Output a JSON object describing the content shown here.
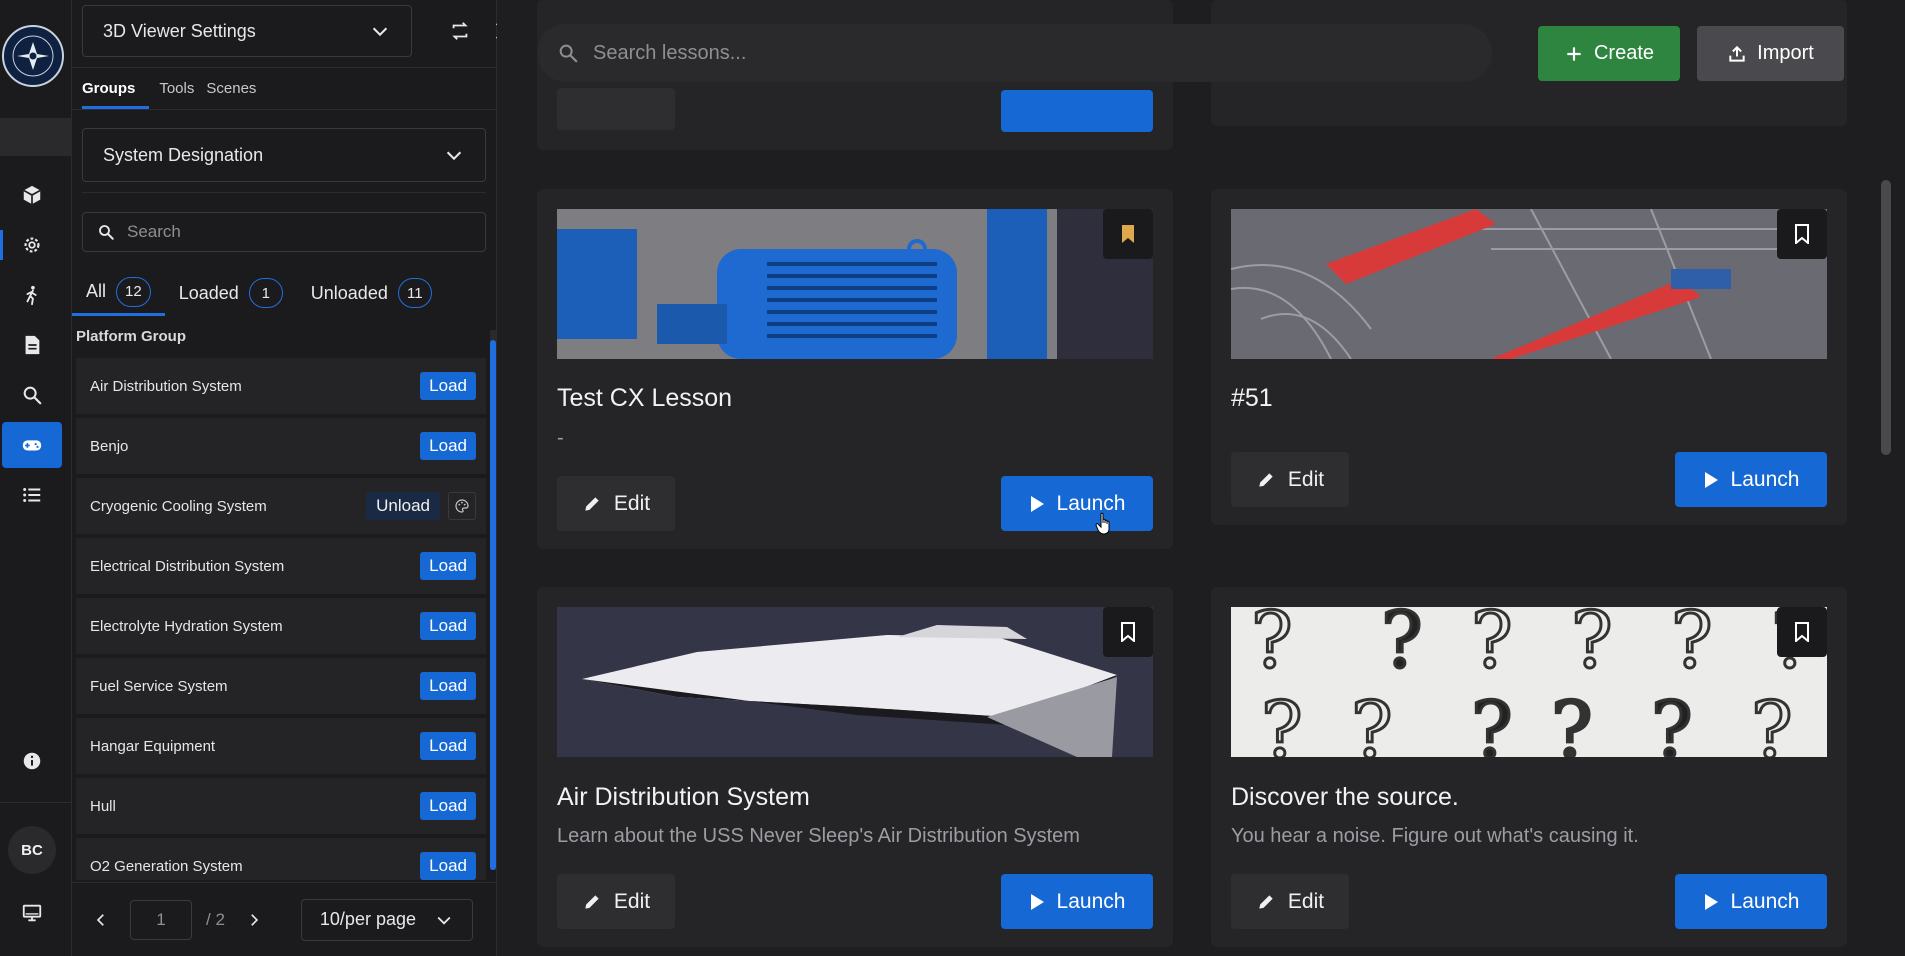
{
  "rail": {
    "avatar_initials": "BC",
    "items": [
      "cube-icon",
      "gear-icon",
      "walk-icon",
      "document-icon",
      "search-icon",
      "gamepad-icon",
      "list-icon"
    ],
    "active_item": "gamepad-icon",
    "selected_item": "gear-icon"
  },
  "panel": {
    "title": "3D Viewer Settings",
    "tabs": [
      {
        "label": "Groups",
        "active": true
      },
      {
        "label": "Tools",
        "active": false
      },
      {
        "label": "Scenes",
        "active": false
      }
    ],
    "designation_select": "System Designation",
    "search_placeholder": "Search",
    "filters": [
      {
        "label": "All",
        "count": "12",
        "active": true
      },
      {
        "label": "Loaded",
        "count": "1",
        "active": false
      },
      {
        "label": "Unloaded",
        "count": "11",
        "active": false
      }
    ],
    "group_title": "Platform Group",
    "groups": [
      {
        "name": "Air Distribution System",
        "action": "Load"
      },
      {
        "name": "Benjo",
        "action": "Load"
      },
      {
        "name": "Cryogenic Cooling System",
        "action": "Unload"
      },
      {
        "name": "Electrical Distribution System",
        "action": "Load"
      },
      {
        "name": "Electrolyte Hydration System",
        "action": "Load"
      },
      {
        "name": "Fuel Service System",
        "action": "Load"
      },
      {
        "name": "Hangar Equipment",
        "action": "Load"
      },
      {
        "name": "Hull",
        "action": "Load"
      },
      {
        "name": "O2 Generation System",
        "action": "Load"
      }
    ],
    "pager": {
      "page": "1",
      "total": "/ 2",
      "per_page": "10/per page"
    }
  },
  "main": {
    "search_placeholder": "Search lessons...",
    "create_label": "Create",
    "import_label": "Import",
    "edit_label": "Edit",
    "launch_label": "Launch",
    "cards": [
      {
        "title": "Test CX Lesson",
        "description": "-",
        "bookmarked": true,
        "bookmark_color": "#e0a84c"
      },
      {
        "title": "#51",
        "description": "",
        "bookmarked": false
      },
      {
        "title": "Air Distribution System",
        "description": "Learn about the USS Never Sleep's Air Distribution System",
        "bookmarked": false
      },
      {
        "title": "Discover the source.",
        "description": "You hear a noise. Figure out what's causing it.",
        "bookmarked": false
      }
    ]
  },
  "colors": {
    "accent_blue": "#1668d4",
    "create_green": "#2e8540",
    "import_gray": "#4a4a4e",
    "background": "#1e1e20"
  }
}
